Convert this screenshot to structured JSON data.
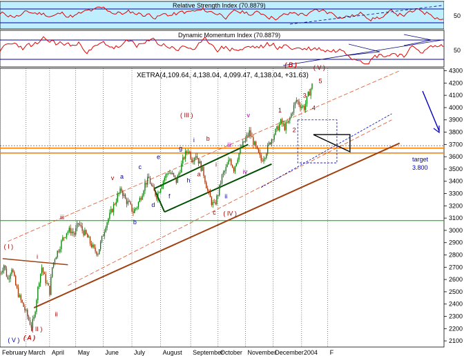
{
  "chart_data": {
    "type": "candlestick",
    "panels": {
      "rsi": {
        "title": "Relative Strength Index (70.8879)",
        "yticks": [
          "50"
        ],
        "colors": {
          "background": "#bfefff",
          "line": "#e00000",
          "levels": "#0000a0"
        }
      },
      "dmi": {
        "title": "Dynamic Momentum Index (70.8879)",
        "yticks": [
          "50"
        ],
        "colors": {
          "background": "#ffffff",
          "line": "#e00000",
          "levels": "#0000a0"
        }
      },
      "price": {
        "header": "XETRA(4,109.64, 4,138.04, 4,099.47, 4,138.04, +31.63)",
        "ylim": [
          2050,
          4320
        ],
        "yticks": [
          2100,
          2200,
          2300,
          2400,
          2500,
          2600,
          2700,
          2800,
          2900,
          3000,
          3100,
          3200,
          3300,
          3400,
          3500,
          3600,
          3700,
          3800,
          3900,
          4000,
          4100,
          4200,
          4300
        ],
        "months": [
          "February",
          "March",
          "April",
          "May",
          "June",
          "July",
          "August",
          "September",
          "October",
          "November",
          "December",
          "2004",
          "F"
        ],
        "x_range": [
          0,
          340
        ],
        "month_starts": [
          0,
          20,
          38,
          58,
          79,
          101,
          123,
          146,
          167,
          188,
          209,
          231,
          251
        ],
        "candles_anchors": [
          [
            0,
            2650
          ],
          [
            3,
            2720
          ],
          [
            6,
            2600
          ],
          [
            9,
            2700
          ],
          [
            12,
            2550
          ],
          [
            15,
            2450
          ],
          [
            18,
            2380
          ],
          [
            21,
            2300
          ],
          [
            24,
            2220
          ],
          [
            26,
            2280
          ],
          [
            28,
            2450
          ],
          [
            30,
            2600
          ],
          [
            32,
            2700
          ],
          [
            34,
            2620
          ],
          [
            36,
            2560
          ],
          [
            38,
            2500
          ],
          [
            40,
            2700
          ],
          [
            42,
            2780
          ],
          [
            45,
            2850
          ],
          [
            48,
            2930
          ],
          [
            51,
            2990
          ],
          [
            54,
            3000
          ],
          [
            57,
            2970
          ],
          [
            60,
            3060
          ],
          [
            63,
            3000
          ],
          [
            66,
            2960
          ],
          [
            69,
            2900
          ],
          [
            72,
            2840
          ],
          [
            75,
            2820
          ],
          [
            78,
            2930
          ],
          [
            81,
            3050
          ],
          [
            84,
            3120
          ],
          [
            87,
            3200
          ],
          [
            90,
            3280
          ],
          [
            93,
            3330
          ],
          [
            96,
            3250
          ],
          [
            99,
            3210
          ],
          [
            102,
            3150
          ],
          [
            105,
            3200
          ],
          [
            108,
            3280
          ],
          [
            111,
            3380
          ],
          [
            114,
            3420
          ],
          [
            117,
            3330
          ],
          [
            120,
            3280
          ],
          [
            123,
            3360
          ],
          [
            126,
            3430
          ],
          [
            129,
            3480
          ],
          [
            132,
            3450
          ],
          [
            135,
            3400
          ],
          [
            138,
            3500
          ],
          [
            141,
            3600
          ],
          [
            144,
            3660
          ],
          [
            147,
            3580
          ],
          [
            150,
            3620
          ],
          [
            153,
            3540
          ],
          [
            156,
            3460
          ],
          [
            159,
            3320
          ],
          [
            162,
            3230
          ],
          [
            164,
            3200
          ],
          [
            167,
            3300
          ],
          [
            170,
            3440
          ],
          [
            173,
            3500
          ],
          [
            176,
            3580
          ],
          [
            179,
            3500
          ],
          [
            182,
            3600
          ],
          [
            185,
            3680
          ],
          [
            188,
            3740
          ],
          [
            191,
            3800
          ],
          [
            194,
            3720
          ],
          [
            197,
            3640
          ],
          [
            200,
            3570
          ],
          [
            203,
            3620
          ],
          [
            206,
            3700
          ],
          [
            209,
            3770
          ],
          [
            212,
            3820
          ],
          [
            215,
            3880
          ],
          [
            218,
            3840
          ],
          [
            221,
            3880
          ],
          [
            224,
            3980
          ],
          [
            227,
            4060
          ],
          [
            230,
            4020
          ],
          [
            233,
            4000
          ],
          [
            236,
            4100
          ],
          [
            239,
            4180
          ]
        ],
        "colors": {
          "up": "#008000",
          "down": "#a03000",
          "grid": "#000000",
          "trend": "#a04010",
          "channel": "#004d00",
          "support": "#00c000",
          "resistance": "#ff8000",
          "elliott": "#a00000",
          "subwave": "#0000a0",
          "target": "#0000b0"
        },
        "horizontal_levels": [
          {
            "name": "support",
            "value": 3080
          },
          {
            "name": "resistance",
            "value": 3670
          },
          {
            "name": "resistance2",
            "value": 3630
          }
        ],
        "annotations": [
          {
            "text": "( I )",
            "x": 3,
            "y": 2850,
            "color": "#a00000"
          },
          {
            "text": "i",
            "x": 28,
            "y": 2770,
            "color": "#a00000"
          },
          {
            "text": "( V )",
            "x": 6,
            "y": 2090,
            "color": "#0000a0"
          },
          {
            "text": "( A )",
            "x": 18,
            "y": 2110,
            "color": "#d00000",
            "italic": true
          },
          {
            "text": "( II )",
            "x": 24,
            "y": 2180,
            "color": "#a00000"
          },
          {
            "text": "ii",
            "x": 42,
            "y": 2300,
            "color": "#a00000"
          },
          {
            "text": "iii",
            "x": 46,
            "y": 3090,
            "color": "#a00000"
          },
          {
            "text": "v",
            "x": 85,
            "y": 3410,
            "color": "#a00000"
          },
          {
            "text": "a",
            "x": 92,
            "y": 3420,
            "color": "#0000a0"
          },
          {
            "text": "b",
            "x": 102,
            "y": 3050,
            "color": "#0000a0"
          },
          {
            "text": "c",
            "x": 106,
            "y": 3500,
            "color": "#0000a0"
          },
          {
            "text": "d",
            "x": 116,
            "y": 3190,
            "color": "#0000a0"
          },
          {
            "text": "e",
            "x": 120,
            "y": 3580,
            "color": "#0000a0"
          },
          {
            "text": "f",
            "x": 129,
            "y": 3260,
            "color": "#0000a0"
          },
          {
            "text": "g",
            "x": 137,
            "y": 3650,
            "color": "#0000a0"
          },
          {
            "text": "h",
            "x": 143,
            "y": 3390,
            "color": "#0000a0"
          },
          {
            "text": "i",
            "x": 148,
            "y": 3720,
            "color": "#0000a0"
          },
          {
            "text": "( III )",
            "x": 138,
            "y": 3920,
            "color": "#a00000"
          },
          {
            "text": "a",
            "x": 151,
            "y": 3440,
            "color": "#a00000"
          },
          {
            "text": "b",
            "x": 158,
            "y": 3730,
            "color": "#a00000"
          },
          {
            "text": "c",
            "x": 163,
            "y": 3130,
            "color": "#a00000"
          },
          {
            "text": "( IV )",
            "x": 171,
            "y": 3120,
            "color": "#a00000"
          },
          {
            "text": "i",
            "x": 165,
            "y": 3520,
            "color": "#a00000"
          },
          {
            "text": "ii",
            "x": 172,
            "y": 3260,
            "color": "#0000a0"
          },
          {
            "text": "iii",
            "x": 174,
            "y": 3680,
            "color": "#a000a0"
          },
          {
            "text": "iv",
            "x": 186,
            "y": 3460,
            "color": "#a000a0"
          },
          {
            "text": "v",
            "x": 189,
            "y": 3920,
            "color": "#a000a0"
          },
          {
            "text": "1",
            "x": 213,
            "y": 3960,
            "color": "#a00000"
          },
          {
            "text": "2",
            "x": 224,
            "y": 3800,
            "color": "#a00000"
          },
          {
            "text": "3",
            "x": 232,
            "y": 4080,
            "color": "#a00000"
          },
          {
            "text": "4",
            "x": 239,
            "y": 3980,
            "color": "#a00000"
          },
          {
            "text": "5",
            "x": 244,
            "y": 4200,
            "color": "#a00000"
          },
          {
            "text": "( V )",
            "x": 240,
            "y": 4310,
            "color": "#a00000"
          },
          {
            "text": "( B )",
            "x": 218,
            "y": 4330,
            "color": "#d00000",
            "italic": true
          }
        ],
        "target_label": "target",
        "target_value": "3.800"
      }
    }
  }
}
